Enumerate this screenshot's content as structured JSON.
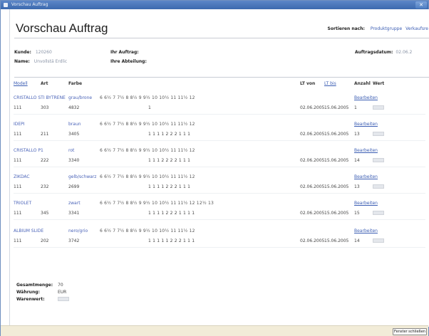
{
  "window": {
    "title": "Vorschau Auftrag",
    "close_glyph": "✕"
  },
  "header": {
    "title": "Vorschau Auftrag",
    "sort_label": "Sortieren nach:",
    "sort_options": [
      "Produktgruppe",
      "Verkaufsre"
    ]
  },
  "meta": {
    "kunde_label": "Kunde:",
    "kunde_value": "120260",
    "name_label": "Name:",
    "name_value": "Unvollstä Erdlic",
    "auftrag_label": "Ihr Auftrag:",
    "abteilung_label": "Ihre Abteilung:",
    "datum_label": "Auftragsdatum:",
    "datum_value": "02.06.2"
  },
  "columns": {
    "modell": "Modell",
    "art": "Art",
    "farbe": "Farbe",
    "lt_von": "LT von",
    "lt_bis": "LT bis",
    "anzahl": "Anzahl",
    "wert": "Wert"
  },
  "positions": [
    {
      "modell": "CRISTALLO STI BYTRENE",
      "farbe_name": "grau/brone",
      "sizes": "6  6½ 7   7½ 8   8½ 9   9½ 10  10½ 11  11½ 12",
      "nr": "111",
      "art": "303",
      "farbe_code": "4832",
      "qtys": "1",
      "lt_von": "02.06.2005",
      "lt_bis": "15.06.2005",
      "anzahl": "1",
      "edit": "Bearbeiten"
    },
    {
      "modell": "IDEPI",
      "farbe_name": "braun",
      "sizes": "6  6½ 7   7½ 8   8½ 9   9½ 10  10½ 11  11½ 12",
      "nr": "111",
      "art": "211",
      "farbe_code": "3405",
      "qtys": "1  1  1  1  2  2  2  1    1  1",
      "lt_von": "02.06.2005",
      "lt_bis": "15.06.2005",
      "anzahl": "13",
      "edit": "Bearbeiten"
    },
    {
      "modell": "CRISTALLO P1",
      "farbe_name": "rot",
      "sizes": "6  6½ 7   7½ 8   8½ 9   9½ 10  10½ 11  11½ 12",
      "nr": "111",
      "art": "222",
      "farbe_code": "3340",
      "qtys": "1  1  1  2  2  2  2  1    1  1",
      "lt_von": "02.06.2005",
      "lt_bis": "15.06.2005",
      "anzahl": "14",
      "edit": "Bearbeiten"
    },
    {
      "modell": "ZIKDAC",
      "farbe_name": "gelb/schwarz",
      "sizes": "6  6½ 7   7½ 8   8½ 9   9½ 10  10½ 11  11½ 12",
      "nr": "111",
      "art": "232",
      "farbe_code": "2699",
      "qtys": "1  1  1  1  2  2  2  1    1  1",
      "lt_von": "02.06.2005",
      "lt_bis": "15.06.2005",
      "anzahl": "13",
      "edit": "Bearbeiten"
    },
    {
      "modell": "TRIOLET",
      "farbe_name": "zwart",
      "sizes": "6  6½ 7   7½ 8   8½ 9   9½ 10  10½ 11  11½ 12  12½ 13",
      "nr": "111",
      "art": "345",
      "farbe_code": "3341",
      "qtys": "1  1  1  1  2  2  2  1    1  1  1",
      "lt_von": "02.06.2005",
      "lt_bis": "15.06.2005",
      "anzahl": "15",
      "edit": "Bearbeiten"
    },
    {
      "modell": "ALBIUM SLIDE",
      "farbe_name": "nero/grio",
      "sizes": "6  6½ 7   7½ 8   8½ 9   9½ 10  10½ 11  11½ 12",
      "nr": "111",
      "art": "202",
      "farbe_code": "3742",
      "qtys": "1  1  1  1  1  2  2  2    1  1   1",
      "lt_von": "02.06.2005",
      "lt_bis": "15.06.2005",
      "anzahl": "14",
      "edit": "Bearbeiten"
    }
  ],
  "totals": {
    "menge_label": "Gesamtmenge:",
    "menge_value": "70",
    "waehrung_label": "Währung:",
    "waehrung_value": "EUR",
    "wert_label": "Warenwert:"
  },
  "footer": {
    "button_label": "Fenster schließen"
  }
}
